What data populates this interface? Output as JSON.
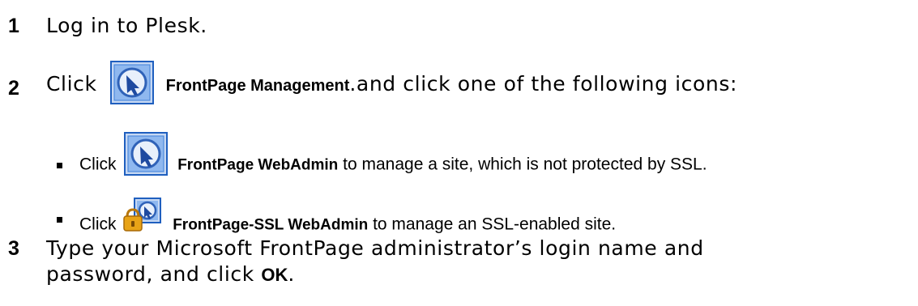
{
  "steps": [
    {
      "number": "1",
      "text": "Log in to Plesk."
    },
    {
      "number": "2",
      "prefix": "Click",
      "icon": "frontpage-management-icon",
      "bold": "FrontPage Management",
      "suffix": ".and click one of the following icons:"
    },
    {
      "number": "3",
      "line1": "Type your Microsoft FrontPage administrator’s login name and",
      "line2_prefix": "password, and click ",
      "line2_bold": "OK",
      "line2_suffix": "."
    }
  ],
  "substeps": [
    {
      "prefix": "Click",
      "icon": "frontpage-webadmin-icon",
      "bold": "FrontPage WebAdmin",
      "suffix": " to manage a site, which is not protected by SSL."
    },
    {
      "prefix": "Click",
      "icon": "frontpage-ssl-webadmin-icon",
      "bold": "FrontPage-SSL WebAdmin",
      "suffix": " to manage an SSL-enabled site."
    }
  ],
  "colors": {
    "icon_border": "#1f5fbf",
    "icon_fill": "#8fb8ef",
    "lock_gold": "#e8a317"
  }
}
